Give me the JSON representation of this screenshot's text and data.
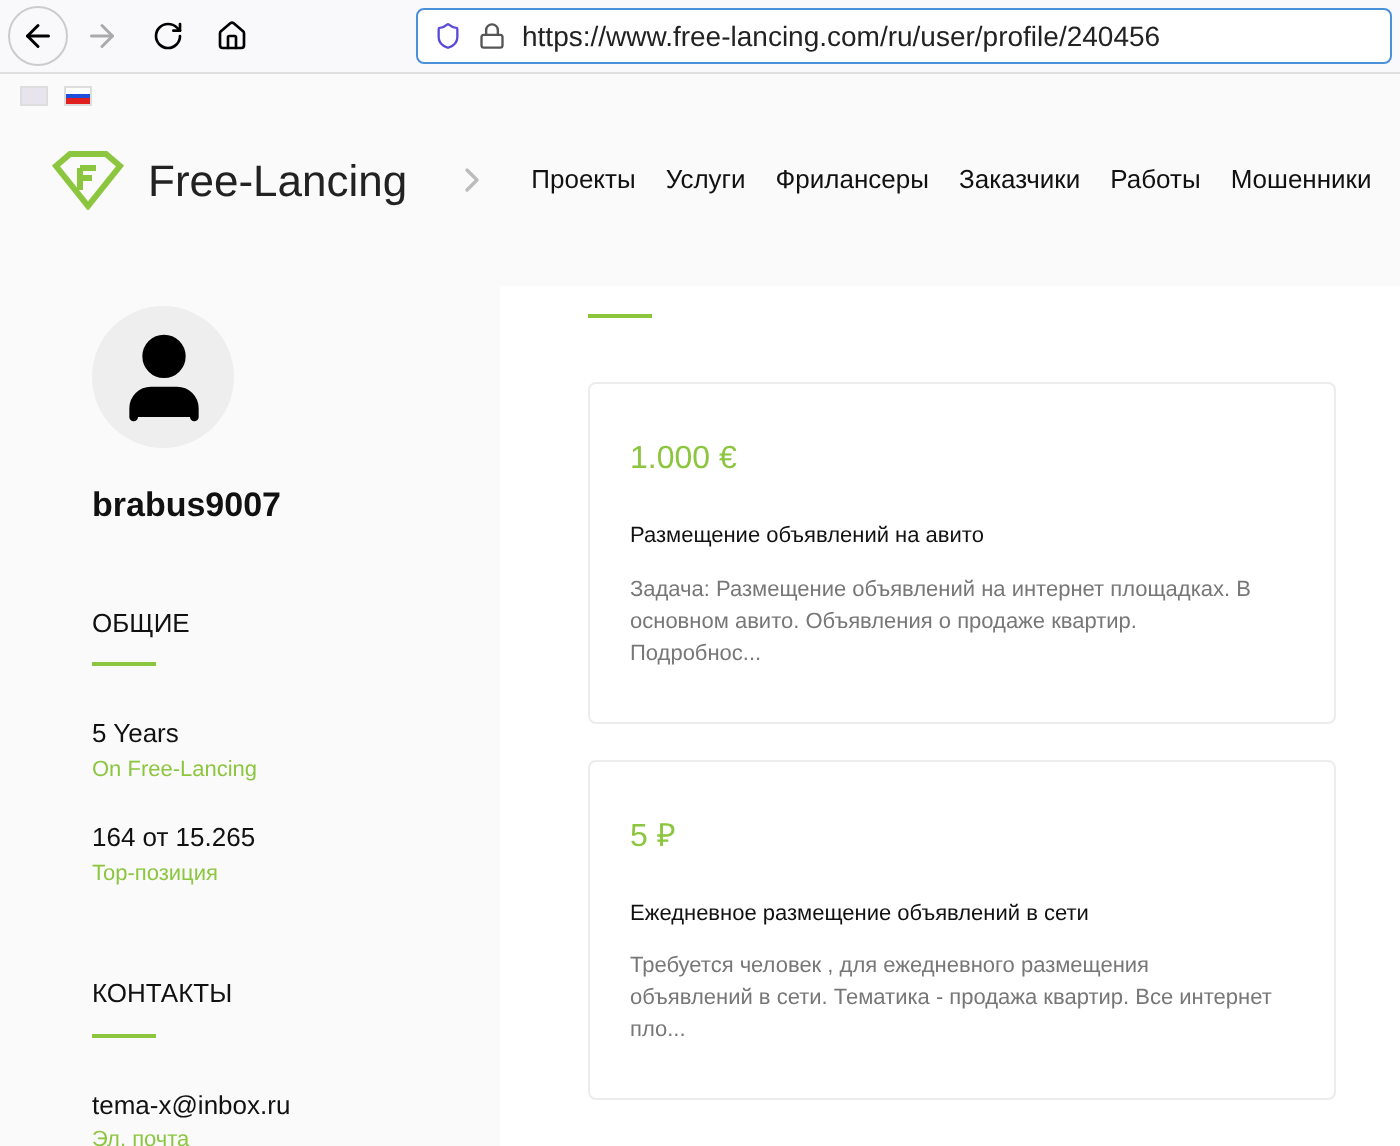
{
  "browser": {
    "url": "https://www.free-lancing.com/ru/user/profile/240456"
  },
  "site": {
    "logo_text": "Free-Lancing",
    "nav": [
      "Проекты",
      "Услуги",
      "Фрилансеры",
      "Заказчики",
      "Работы",
      "Мошенники"
    ]
  },
  "profile": {
    "username": "brabus9007",
    "sections": [
      {
        "title": "ОБЩИЕ",
        "items": [
          {
            "value": "5 Years",
            "label": "On Free-Lancing"
          },
          {
            "value": "164 от 15.265",
            "label": "Top-позиция"
          }
        ]
      },
      {
        "title": "КОНТАКТЫ",
        "items": [
          {
            "value": "tema-x@inbox.ru",
            "label": "Эл. почта"
          }
        ]
      }
    ]
  },
  "projects": [
    {
      "price": "1.000 €",
      "title": "Размещение объявлений на авито",
      "description": "Задача: Размещение объявлений на интернет площадках. В основном авито. Объявления о продаже квартир. Подробнос..."
    },
    {
      "price": "5 ₽",
      "title": "Ежедневное размещение объявлений в сети",
      "description": "Требуется человек , для ежедневного размещения объявлений в сети. Тематика - продажа квартир. Все интернет пло..."
    }
  ]
}
